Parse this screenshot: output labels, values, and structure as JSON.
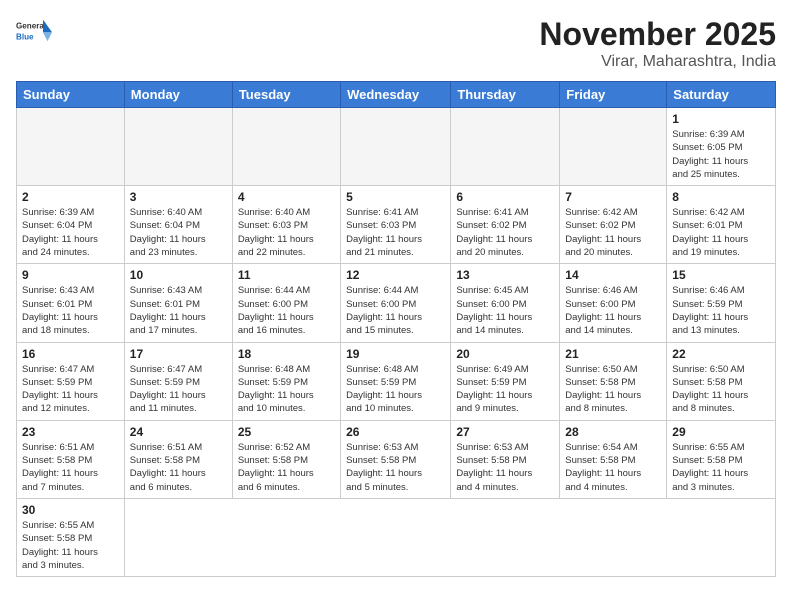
{
  "header": {
    "logo_general": "General",
    "logo_blue": "Blue",
    "month": "November 2025",
    "location": "Virar, Maharashtra, India"
  },
  "weekdays": [
    "Sunday",
    "Monday",
    "Tuesday",
    "Wednesday",
    "Thursday",
    "Friday",
    "Saturday"
  ],
  "days": [
    {
      "num": "",
      "info": ""
    },
    {
      "num": "",
      "info": ""
    },
    {
      "num": "",
      "info": ""
    },
    {
      "num": "",
      "info": ""
    },
    {
      "num": "",
      "info": ""
    },
    {
      "num": "",
      "info": ""
    },
    {
      "num": "1",
      "info": "Sunrise: 6:39 AM\nSunset: 6:05 PM\nDaylight: 11 hours\nand 25 minutes."
    },
    {
      "num": "2",
      "info": "Sunrise: 6:39 AM\nSunset: 6:04 PM\nDaylight: 11 hours\nand 24 minutes."
    },
    {
      "num": "3",
      "info": "Sunrise: 6:40 AM\nSunset: 6:04 PM\nDaylight: 11 hours\nand 23 minutes."
    },
    {
      "num": "4",
      "info": "Sunrise: 6:40 AM\nSunset: 6:03 PM\nDaylight: 11 hours\nand 22 minutes."
    },
    {
      "num": "5",
      "info": "Sunrise: 6:41 AM\nSunset: 6:03 PM\nDaylight: 11 hours\nand 21 minutes."
    },
    {
      "num": "6",
      "info": "Sunrise: 6:41 AM\nSunset: 6:02 PM\nDaylight: 11 hours\nand 20 minutes."
    },
    {
      "num": "7",
      "info": "Sunrise: 6:42 AM\nSunset: 6:02 PM\nDaylight: 11 hours\nand 20 minutes."
    },
    {
      "num": "8",
      "info": "Sunrise: 6:42 AM\nSunset: 6:01 PM\nDaylight: 11 hours\nand 19 minutes."
    },
    {
      "num": "9",
      "info": "Sunrise: 6:43 AM\nSunset: 6:01 PM\nDaylight: 11 hours\nand 18 minutes."
    },
    {
      "num": "10",
      "info": "Sunrise: 6:43 AM\nSunset: 6:01 PM\nDaylight: 11 hours\nand 17 minutes."
    },
    {
      "num": "11",
      "info": "Sunrise: 6:44 AM\nSunset: 6:00 PM\nDaylight: 11 hours\nand 16 minutes."
    },
    {
      "num": "12",
      "info": "Sunrise: 6:44 AM\nSunset: 6:00 PM\nDaylight: 11 hours\nand 15 minutes."
    },
    {
      "num": "13",
      "info": "Sunrise: 6:45 AM\nSunset: 6:00 PM\nDaylight: 11 hours\nand 14 minutes."
    },
    {
      "num": "14",
      "info": "Sunrise: 6:46 AM\nSunset: 6:00 PM\nDaylight: 11 hours\nand 14 minutes."
    },
    {
      "num": "15",
      "info": "Sunrise: 6:46 AM\nSunset: 5:59 PM\nDaylight: 11 hours\nand 13 minutes."
    },
    {
      "num": "16",
      "info": "Sunrise: 6:47 AM\nSunset: 5:59 PM\nDaylight: 11 hours\nand 12 minutes."
    },
    {
      "num": "17",
      "info": "Sunrise: 6:47 AM\nSunset: 5:59 PM\nDaylight: 11 hours\nand 11 minutes."
    },
    {
      "num": "18",
      "info": "Sunrise: 6:48 AM\nSunset: 5:59 PM\nDaylight: 11 hours\nand 10 minutes."
    },
    {
      "num": "19",
      "info": "Sunrise: 6:48 AM\nSunset: 5:59 PM\nDaylight: 11 hours\nand 10 minutes."
    },
    {
      "num": "20",
      "info": "Sunrise: 6:49 AM\nSunset: 5:59 PM\nDaylight: 11 hours\nand 9 minutes."
    },
    {
      "num": "21",
      "info": "Sunrise: 6:50 AM\nSunset: 5:58 PM\nDaylight: 11 hours\nand 8 minutes."
    },
    {
      "num": "22",
      "info": "Sunrise: 6:50 AM\nSunset: 5:58 PM\nDaylight: 11 hours\nand 8 minutes."
    },
    {
      "num": "23",
      "info": "Sunrise: 6:51 AM\nSunset: 5:58 PM\nDaylight: 11 hours\nand 7 minutes."
    },
    {
      "num": "24",
      "info": "Sunrise: 6:51 AM\nSunset: 5:58 PM\nDaylight: 11 hours\nand 6 minutes."
    },
    {
      "num": "25",
      "info": "Sunrise: 6:52 AM\nSunset: 5:58 PM\nDaylight: 11 hours\nand 6 minutes."
    },
    {
      "num": "26",
      "info": "Sunrise: 6:53 AM\nSunset: 5:58 PM\nDaylight: 11 hours\nand 5 minutes."
    },
    {
      "num": "27",
      "info": "Sunrise: 6:53 AM\nSunset: 5:58 PM\nDaylight: 11 hours\nand 4 minutes."
    },
    {
      "num": "28",
      "info": "Sunrise: 6:54 AM\nSunset: 5:58 PM\nDaylight: 11 hours\nand 4 minutes."
    },
    {
      "num": "29",
      "info": "Sunrise: 6:55 AM\nSunset: 5:58 PM\nDaylight: 11 hours\nand 3 minutes."
    },
    {
      "num": "30",
      "info": "Sunrise: 6:55 AM\nSunset: 5:58 PM\nDaylight: 11 hours\nand 3 minutes."
    }
  ]
}
